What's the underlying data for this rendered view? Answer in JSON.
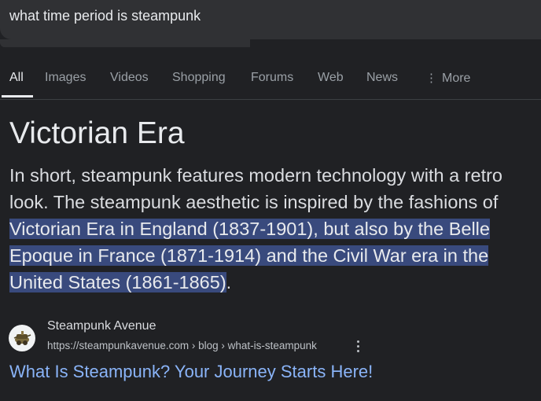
{
  "search": {
    "query": "what time period is steampunk"
  },
  "tabs": [
    {
      "label": "All",
      "active": true
    },
    {
      "label": "Images"
    },
    {
      "label": "Videos"
    },
    {
      "label": "Shopping"
    },
    {
      "label": "Forums"
    },
    {
      "label": "Web"
    },
    {
      "label": "News"
    },
    {
      "label": "More",
      "icon": "more-vert-icon"
    }
  ],
  "answer": {
    "title": "Victorian Era",
    "text_plain": "In short, steampunk features modern technology with a retro look. The steampunk aesthetic is inspired by the fashions of ",
    "text_highlighted": "Victorian Era in England (1837-1901), but also by the Belle Epoque in France (1871-1914) and the Civil War era in the United States (1861-1865)",
    "text_end": "."
  },
  "source": {
    "name": "Steampunk Avenue",
    "url": "https://steampunkavenue.com › blog › what-is-steampunk",
    "favicon": "steampunk-logo-icon",
    "menu_icon": "more-vert-icon"
  },
  "result": {
    "link_text": "What Is Steampunk? Your Journey Starts Here!"
  },
  "colors": {
    "background": "#202124",
    "link": "#8ab4f8",
    "highlight": "#394a7d"
  }
}
